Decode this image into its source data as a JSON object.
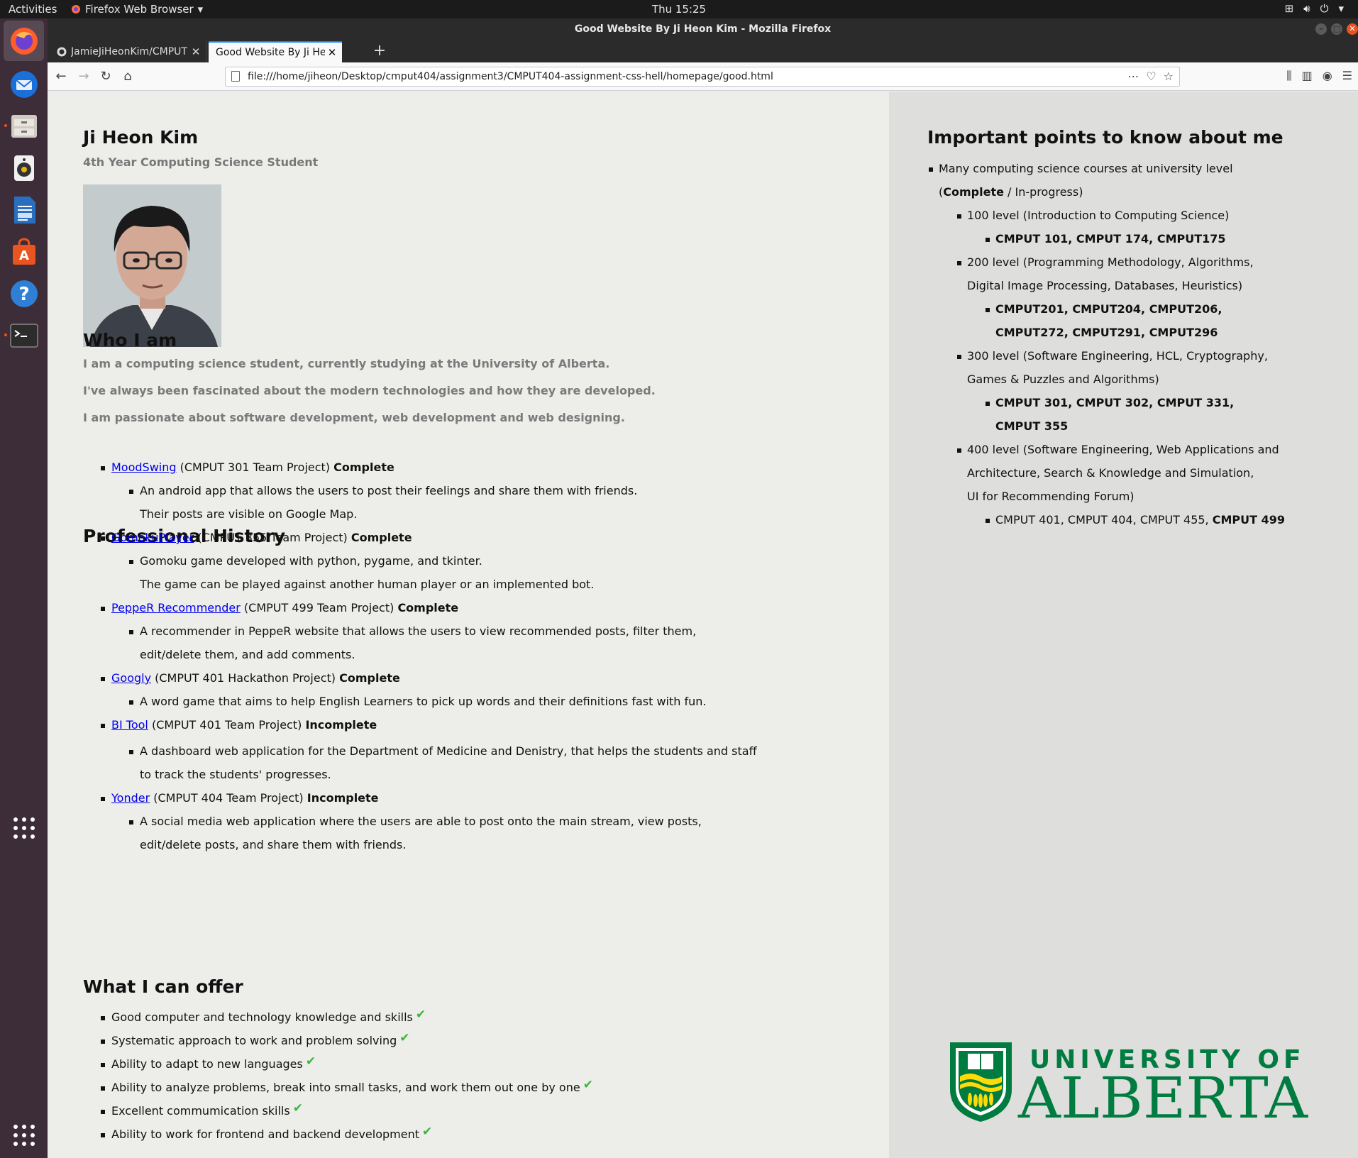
{
  "system": {
    "activities": "Activities",
    "app_menu": "Firefox Web Browser",
    "clock": "Thu 15:25"
  },
  "window": {
    "title": "Good Website By Ji Heon Kim - Mozilla Firefox"
  },
  "tabs": [
    {
      "label": "JamieJiHeonKim/CMPUT",
      "active": false
    },
    {
      "label": "Good Website By Ji Heon Ki",
      "active": true
    }
  ],
  "urlbar": {
    "url": "file:///home/jiheon/Desktop/cmput404/assignment3/CMPUT404-assignment-css-hell/homepage/good.html"
  },
  "profile": {
    "name": "Ji Heon Kim",
    "subtitle": "4th Year Computing Science Student"
  },
  "who": {
    "heading": "Who I am",
    "lines": [
      "I am a computing science student, currently studying at the University of Alberta.",
      "I've always been fascinated about the modern technologies and how they are developed.",
      "I am passionate about software development, web development and web designing."
    ]
  },
  "history": {
    "heading": "Professional History",
    "projects": [
      {
        "link": "MoodSwing",
        "context": " (CMPUT 301 Team Project) ",
        "status": "Complete",
        "desc": [
          "An android app that allows the users to post their feelings and share them with friends.",
          "Their posts are visible on Google Map."
        ]
      },
      {
        "link": "GomokuPlayer",
        "context": " (CMPUT 355 Team Project) ",
        "status": "Complete",
        "desc": [
          "Gomoku game developed with python, pygame, and tkinter.",
          "The game can be played against another human player or an implemented bot."
        ]
      },
      {
        "link": "PeppeR Recommender",
        "context": " (CMPUT 499 Team Project) ",
        "status": "Complete",
        "desc": [
          "A recommender in PeppeR website that allows the users to view recommended posts, filter them,",
          "edit/delete them, and add comments."
        ]
      },
      {
        "link": "Googly",
        "context": " (CMPUT 401 Hackathon Project) ",
        "status": "Complete",
        "desc": [
          "A word game that aims to help English Learners to pick up words and their definitions fast with fun."
        ]
      },
      {
        "link": "BI Tool",
        "context": " (CMPUT 401 Team Project) ",
        "status": "Incomplete",
        "desc": [
          "A dashboard web application for the Department of Medicine and Denistry, that helps the students and staff",
          "to track the students' progresses."
        ]
      },
      {
        "link": "Yonder",
        "context": " (CMPUT 404 Team Project) ",
        "status": "Incomplete",
        "desc": [
          "A social media web application where the users are able to post onto the main stream, view posts,",
          "edit/delete posts, and share them with friends."
        ]
      }
    ]
  },
  "offer": {
    "heading": "What I can offer",
    "items": [
      "Good computer and technology knowledge and skills",
      "Systematic approach to work and problem solving",
      "Ability to adapt to new languages",
      "Ability to analyze problems, break into small tasks, and work them out one by one",
      "Excellent commumication skills",
      "Ability to work for frontend and backend development"
    ],
    "check_glyph": "✔"
  },
  "points": {
    "heading": "Important points to know about me",
    "intro": "Many computing science courses at university level",
    "legend_open": "(",
    "legend_complete": "Complete",
    "legend_rest": " / In-progress)",
    "levels": [
      {
        "label": [
          "100 level (Introduction to Computing Science)"
        ],
        "courses": [
          "CMPUT 101, CMPUT 174, CMPUT175"
        ]
      },
      {
        "label": [
          "200 level (Programming Methodology, Algorithms,",
          "Digital Image Processing, Databases, Heuristics)"
        ],
        "courses": [
          "CMPUT201, CMPUT204, CMPUT206,",
          "CMPUT272, CMPUT291, CMPUT296"
        ]
      },
      {
        "label": [
          "300 level (Software Engineering, HCL, Cryptography,",
          "Games & Puzzles and Algorithms)"
        ],
        "courses": [
          "CMPUT 301, CMPUT 302, CMPUT 331,",
          "CMPUT 355"
        ]
      },
      {
        "label": [
          "400 level (Software Engineering, Web Applications and",
          "Architecture, Search & Knowledge and Simulation,",
          "UI for Recommending Forum)"
        ]
      }
    ],
    "last_courses_plain": "CMPUT 401, CMPUT 404, CMPUT 455, ",
    "last_courses_bold": "CMPUT 499"
  },
  "logo": {
    "line1": "UNIVERSITY OF",
    "line2": "ALBERTA",
    "green": "#007c41",
    "gold": "#ffdb05"
  }
}
